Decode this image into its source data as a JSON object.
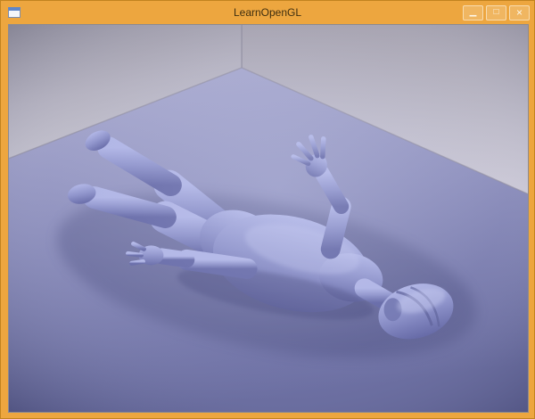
{
  "window": {
    "title": "LearnOpenGL",
    "controls": {
      "minimize": "▁",
      "maximize": "□",
      "close": "×"
    }
  },
  "colors": {
    "titlebar": "#eda63f",
    "frame_border": "#c2831f",
    "title_text": "#3f2f10",
    "wall": "#b7b4c1",
    "floor": "#7f81b0",
    "model": "#868bc4",
    "shadow": "#35386a"
  }
}
